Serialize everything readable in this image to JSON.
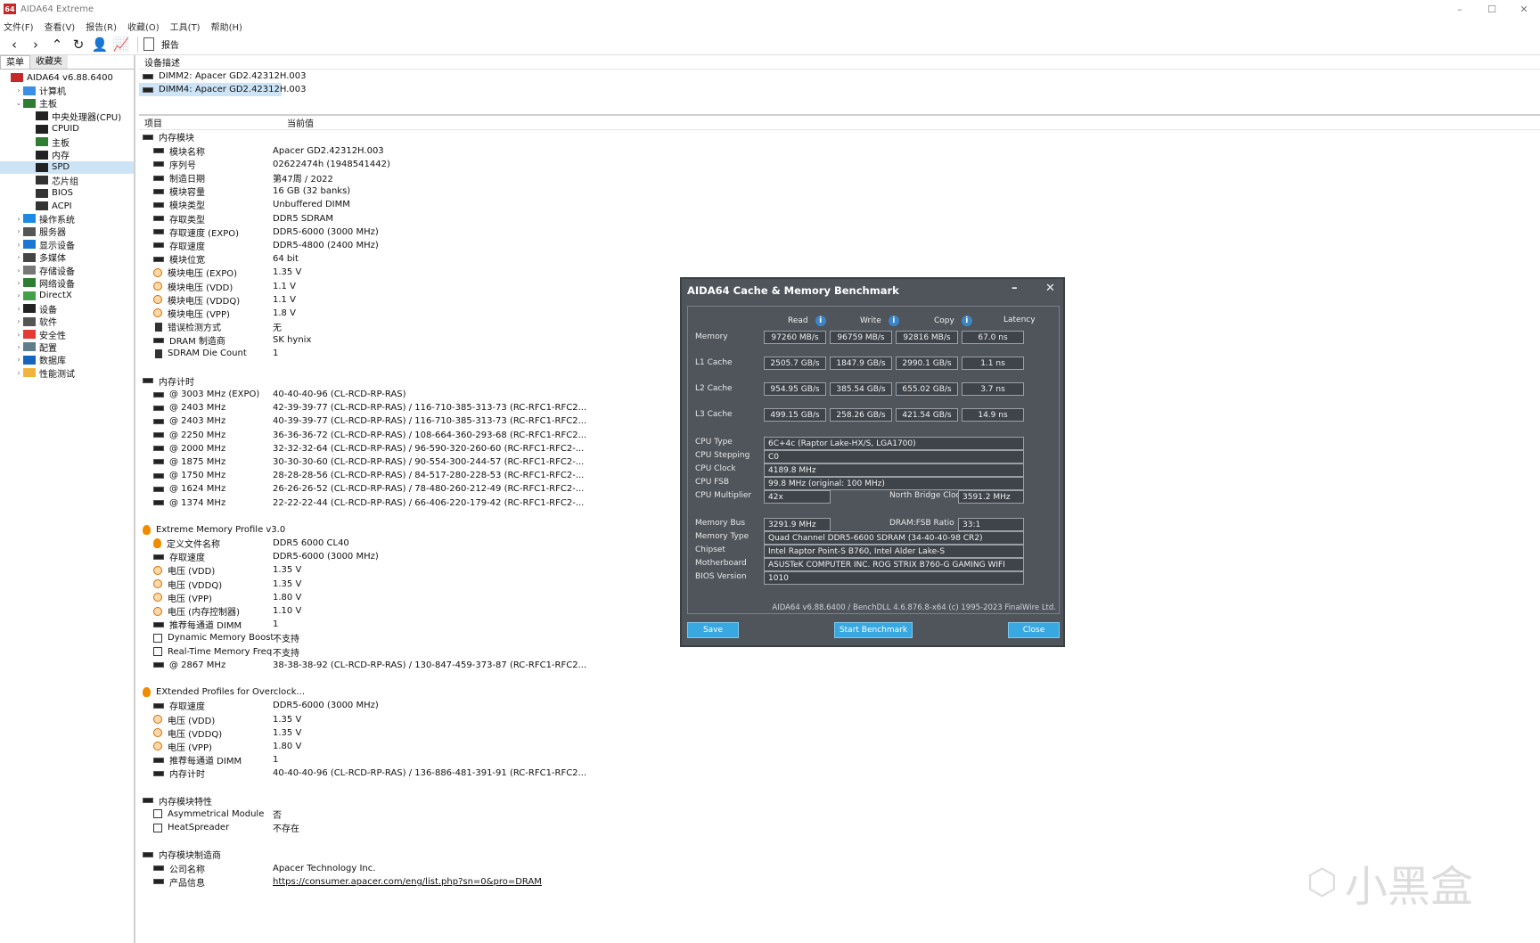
{
  "window": {
    "title": "AIDA64 Extreme",
    "icon_text": "64"
  },
  "menu": [
    "文件(F)",
    "查看(V)",
    "报告(R)",
    "收藏(O)",
    "工具(T)",
    "帮助(H)"
  ],
  "toolbar": {
    "report_label": "报告"
  },
  "left": {
    "tabs": [
      "菜单",
      "收藏夹"
    ],
    "tree": [
      {
        "label": "AIDA64 v6.88.6400",
        "level": 0,
        "arrow": "",
        "icon": "aida"
      },
      {
        "label": "计算机",
        "level": 1,
        "arrow": "›",
        "icon": "computer"
      },
      {
        "label": "主板",
        "level": 1,
        "arrow": "⌄",
        "icon": "board"
      },
      {
        "label": "中央处理器(CPU)",
        "level": 2,
        "arrow": "",
        "icon": "cpu"
      },
      {
        "label": "CPUID",
        "level": 2,
        "arrow": "",
        "icon": "cpu"
      },
      {
        "label": "主板",
        "level": 2,
        "arrow": "",
        "icon": "board"
      },
      {
        "label": "内存",
        "level": 2,
        "arrow": "",
        "icon": "ram"
      },
      {
        "label": "SPD",
        "level": 2,
        "arrow": "",
        "icon": "ram",
        "selected": true
      },
      {
        "label": "芯片组",
        "level": 2,
        "arrow": "",
        "icon": "chip"
      },
      {
        "label": "BIOS",
        "level": 2,
        "arrow": "",
        "icon": "chip"
      },
      {
        "label": "ACPI",
        "level": 2,
        "arrow": "",
        "icon": "chip"
      },
      {
        "label": "操作系统",
        "level": 1,
        "arrow": "›",
        "icon": "windows"
      },
      {
        "label": "服务器",
        "level": 1,
        "arrow": "›",
        "icon": "server"
      },
      {
        "label": "显示设备",
        "level": 1,
        "arrow": "›",
        "icon": "display"
      },
      {
        "label": "多媒体",
        "level": 1,
        "arrow": "›",
        "icon": "speaker"
      },
      {
        "label": "存储设备",
        "level": 1,
        "arrow": "›",
        "icon": "storage"
      },
      {
        "label": "网络设备",
        "level": 1,
        "arrow": "›",
        "icon": "network"
      },
      {
        "label": "DirectX",
        "level": 1,
        "arrow": "›",
        "icon": "directx"
      },
      {
        "label": "设备",
        "level": 1,
        "arrow": "›",
        "icon": "device"
      },
      {
        "label": "软件",
        "level": 1,
        "arrow": "›",
        "icon": "software"
      },
      {
        "label": "安全性",
        "level": 1,
        "arrow": "›",
        "icon": "shield"
      },
      {
        "label": "配置",
        "level": 1,
        "arrow": "›",
        "icon": "config"
      },
      {
        "label": "数据库",
        "level": 1,
        "arrow": "›",
        "icon": "database"
      },
      {
        "label": "性能测试",
        "level": 1,
        "arrow": "›",
        "icon": "folder"
      }
    ]
  },
  "devices": {
    "header": "设备描述",
    "items": [
      "DIMM2: Apacer GD2.42312H.003",
      "DIMM4: Apacer GD2.42312H.003"
    ]
  },
  "columns": {
    "item": "项目",
    "value": "当前值"
  },
  "sections": [
    {
      "title": "内存模块",
      "icon": "ram",
      "rows": [
        {
          "name": "模块名称",
          "value": "Apacer GD2.42312H.003",
          "icon": "ram"
        },
        {
          "name": "序列号",
          "value": "02622474h (1948541442)",
          "icon": "ram"
        },
        {
          "name": "制造日期",
          "value": "第47周 / 2022",
          "icon": "ram"
        },
        {
          "name": "模块容量",
          "value": "16 GB (32 banks)",
          "icon": "ram"
        },
        {
          "name": "模块类型",
          "value": "Unbuffered DIMM",
          "icon": "ram"
        },
        {
          "name": "存取类型",
          "value": "DDR5 SDRAM",
          "icon": "ram"
        },
        {
          "name": "存取速度 (EXPO)",
          "value": "DDR5-6000 (3000 MHz)",
          "icon": "ram"
        },
        {
          "name": "存取速度",
          "value": "DDR5-4800 (2400 MHz)",
          "icon": "ram"
        },
        {
          "name": "模块位宽",
          "value": "64 bit",
          "icon": "ram"
        },
        {
          "name": "模块电压 (EXPO)",
          "value": "1.35 V",
          "icon": "volt"
        },
        {
          "name": "模块电压 (VDD)",
          "value": "1.1 V",
          "icon": "volt"
        },
        {
          "name": "模块电压 (VDDQ)",
          "value": "1.1 V",
          "icon": "volt"
        },
        {
          "name": "模块电压 (VPP)",
          "value": "1.8 V",
          "icon": "volt"
        },
        {
          "name": "错误检测方式",
          "value": "无",
          "icon": "chip"
        },
        {
          "name": "DRAM 制造商",
          "value": "SK hynix",
          "icon": "ram"
        },
        {
          "name": "SDRAM Die Count",
          "value": "1",
          "icon": "chip"
        }
      ]
    },
    {
      "title": "内存计时",
      "icon": "ram",
      "rows": [
        {
          "name": "@ 3003 MHz (EXPO)",
          "value": "40-40-40-96  (CL-RCD-RP-RAS)",
          "icon": "ram"
        },
        {
          "name": "@ 2403 MHz",
          "value": "42-39-39-77  (CL-RCD-RP-RAS) / 116-710-385-313-73  (RC-RFC1-RFC2...",
          "icon": "ram"
        },
        {
          "name": "@ 2403 MHz",
          "value": "40-39-39-77  (CL-RCD-RP-RAS) / 116-710-385-313-73  (RC-RFC1-RFC2...",
          "icon": "ram"
        },
        {
          "name": "@ 2250 MHz",
          "value": "36-36-36-72  (CL-RCD-RP-RAS) / 108-664-360-293-68  (RC-RFC1-RFC2...",
          "icon": "ram"
        },
        {
          "name": "@ 2000 MHz",
          "value": "32-32-32-64  (CL-RCD-RP-RAS) / 96-590-320-260-60  (RC-RFC1-RFC2-...",
          "icon": "ram"
        },
        {
          "name": "@ 1875 MHz",
          "value": "30-30-30-60  (CL-RCD-RP-RAS) / 90-554-300-244-57  (RC-RFC1-RFC2-...",
          "icon": "ram"
        },
        {
          "name": "@ 1750 MHz",
          "value": "28-28-28-56  (CL-RCD-RP-RAS) / 84-517-280-228-53  (RC-RFC1-RFC2-...",
          "icon": "ram"
        },
        {
          "name": "@ 1624 MHz",
          "value": "26-26-26-52  (CL-RCD-RP-RAS) / 78-480-260-212-49  (RC-RFC1-RFC2-...",
          "icon": "ram"
        },
        {
          "name": "@ 1374 MHz",
          "value": "22-22-22-44  (CL-RCD-RP-RAS) / 66-406-220-179-42  (RC-RFC1-RFC2-...",
          "icon": "ram"
        }
      ]
    },
    {
      "title": "Extreme Memory Profile v3.0",
      "icon": "flame",
      "rows": [
        {
          "name": "定义文件名称",
          "value": "DDR5 6000 CL40",
          "icon": "flame"
        },
        {
          "name": "存取速度",
          "value": "DDR5-6000 (3000 MHz)",
          "icon": "ram"
        },
        {
          "name": "电压 (VDD)",
          "value": "1.35 V",
          "icon": "volt"
        },
        {
          "name": "电压 (VDDQ)",
          "value": "1.35 V",
          "icon": "volt"
        },
        {
          "name": "电压 (VPP)",
          "value": "1.80 V",
          "icon": "volt"
        },
        {
          "name": "电压 (内存控制器)",
          "value": "1.10 V",
          "icon": "volt"
        },
        {
          "name": "推荐每通道 DIMM",
          "value": "1",
          "icon": "ram"
        },
        {
          "name": "Dynamic Memory Boost",
          "value": "不支持",
          "icon": "chk"
        },
        {
          "name": "Real-Time Memory Frequen...",
          "value": "不支持",
          "icon": "chk"
        },
        {
          "name": "@ 2867 MHz",
          "value": "38-38-38-92  (CL-RCD-RP-RAS) / 130-847-459-373-87  (RC-RFC1-RFC2...",
          "icon": "ram"
        }
      ]
    },
    {
      "title": "EXtended Profiles for Overclock...",
      "icon": "flame",
      "rows": [
        {
          "name": "存取速度",
          "value": "DDR5-6000 (3000 MHz)",
          "icon": "ram"
        },
        {
          "name": "电压 (VDD)",
          "value": "1.35 V",
          "icon": "volt"
        },
        {
          "name": "电压 (VDDQ)",
          "value": "1.35 V",
          "icon": "volt"
        },
        {
          "name": "电压 (VPP)",
          "value": "1.80 V",
          "icon": "volt"
        },
        {
          "name": "推荐每通道 DIMM",
          "value": "1",
          "icon": "ram"
        },
        {
          "name": "内存计时",
          "value": "40-40-40-96  (CL-RCD-RP-RAS) / 136-886-481-391-91  (RC-RFC1-RFC2...",
          "icon": "ram"
        }
      ]
    },
    {
      "title": "内存模块特性",
      "icon": "ram",
      "rows": [
        {
          "name": "Asymmetrical Module",
          "value": "否",
          "icon": "chk"
        },
        {
          "name": "HeatSpreader",
          "value": "不存在",
          "icon": "chk"
        }
      ]
    },
    {
      "title": "内存模块制造商",
      "icon": "ram",
      "rows": [
        {
          "name": "公司名称",
          "value": "Apacer Technology Inc.",
          "icon": "ram"
        },
        {
          "name": "产品信息",
          "value": "https://consumer.apacer.com/eng/list.php?sn=0&pro=DRAM",
          "icon": "ram",
          "link": true
        }
      ]
    }
  ],
  "benchmark": {
    "title": "AIDA64 Cache & Memory Benchmark",
    "headers": [
      "Read",
      "Write",
      "Copy",
      "Latency"
    ],
    "rows": [
      {
        "label": "Memory",
        "values": [
          "97260 MB/s",
          "96759 MB/s",
          "92816 MB/s",
          "67.0 ns"
        ]
      },
      {
        "label": "L1 Cache",
        "values": [
          "2505.7 GB/s",
          "1847.9 GB/s",
          "2990.1 GB/s",
          "1.1 ns"
        ]
      },
      {
        "label": "L2 Cache",
        "values": [
          "954.95 GB/s",
          "385.54 GB/s",
          "655.02 GB/s",
          "3.7 ns"
        ]
      },
      {
        "label": "L3 Cache",
        "values": [
          "499.15 GB/s",
          "258.26 GB/s",
          "421.54 GB/s",
          "14.9 ns"
        ]
      }
    ],
    "cpu_type_label": "CPU Type",
    "cpu_type": "6C+4c   (Raptor Lake-HX/S, LGA1700)",
    "cpu_stepping_label": "CPU Stepping",
    "cpu_stepping": "C0",
    "cpu_clock_label": "CPU Clock",
    "cpu_clock": "4189.8 MHz",
    "cpu_fsb_label": "CPU FSB",
    "cpu_fsb": "99.8 MHz  (original: 100 MHz)",
    "cpu_mult_label": "CPU Multiplier",
    "cpu_mult": "42x",
    "nb_clock_label": "North Bridge Clock",
    "nb_clock": "3591.2 MHz",
    "mem_bus_label": "Memory Bus",
    "mem_bus": "3291.9 MHz",
    "dram_fsb_label": "DRAM:FSB Ratio",
    "dram_fsb": "33:1",
    "mem_type_label": "Memory Type",
    "mem_type": "Quad Channel DDR5-6600 SDRAM  (34-40-40-98 CR2)",
    "chipset_label": "Chipset",
    "chipset": "Intel Raptor Point-S B760, Intel Alder Lake-S",
    "mobo_label": "Motherboard",
    "mobo": "ASUSTeK COMPUTER INC. ROG STRIX B760-G GAMING WIFI",
    "bios_label": "BIOS Version",
    "bios": "1010",
    "footer": "AIDA64 v6.88.6400 / BenchDLL 4.6.876.8-x64  (c) 1995-2023 FinalWire Ltd.",
    "save": "Save",
    "start": "Start Benchmark",
    "close": "Close"
  },
  "watermark": "小黑盒"
}
